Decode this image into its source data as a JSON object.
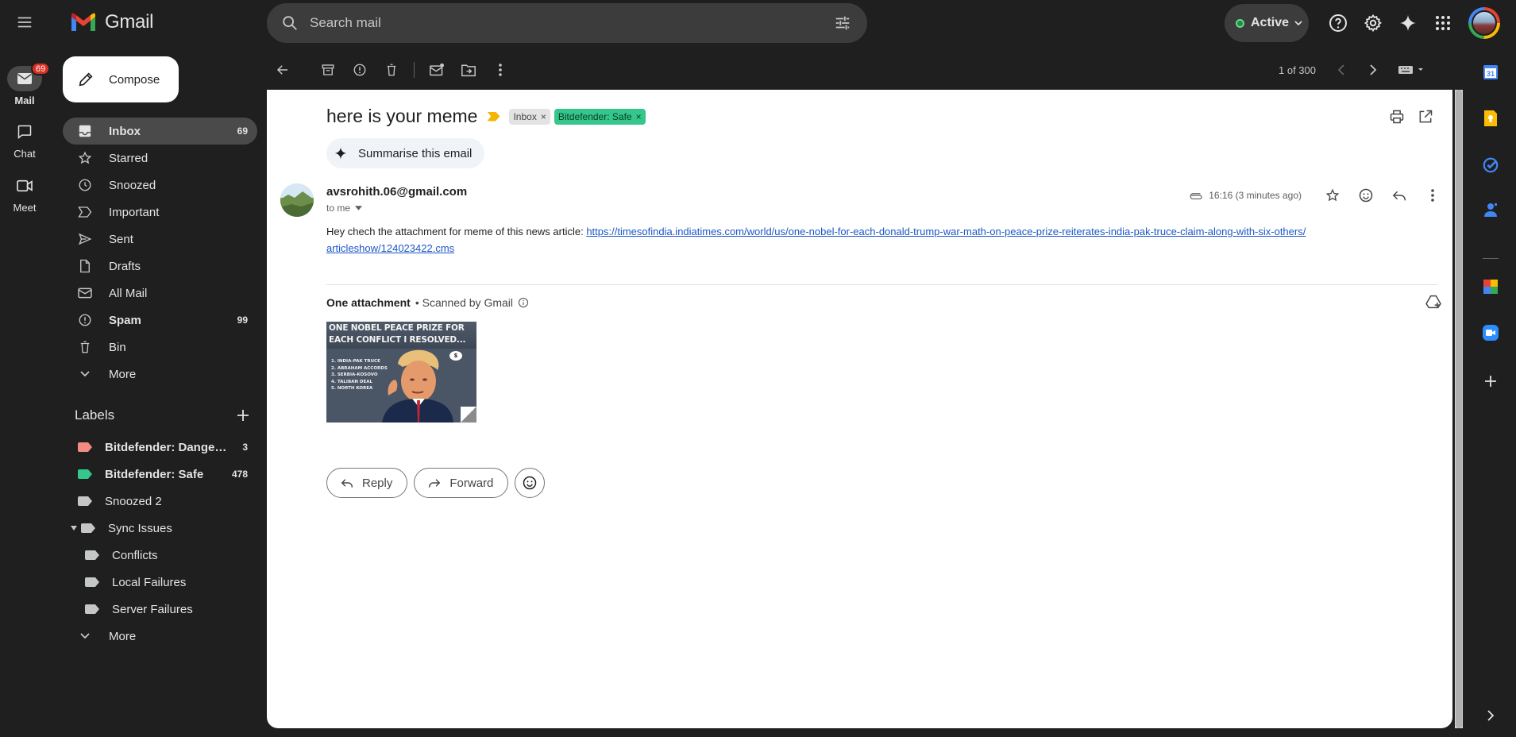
{
  "app": {
    "name": "Gmail"
  },
  "search": {
    "placeholder": "Search mail"
  },
  "status": {
    "label": "Active"
  },
  "rail": {
    "items": [
      {
        "label": "Mail",
        "badge": "69",
        "active": true
      },
      {
        "label": "Chat"
      },
      {
        "label": "Meet"
      }
    ]
  },
  "compose": {
    "label": "Compose"
  },
  "nav": {
    "items": [
      {
        "label": "Inbox",
        "count": "69"
      },
      {
        "label": "Starred",
        "count": ""
      },
      {
        "label": "Snoozed",
        "count": ""
      },
      {
        "label": "Important",
        "count": ""
      },
      {
        "label": "Sent",
        "count": ""
      },
      {
        "label": "Drafts",
        "count": ""
      },
      {
        "label": "All Mail",
        "count": ""
      },
      {
        "label": "Spam",
        "count": "99"
      },
      {
        "label": "Bin",
        "count": ""
      },
      {
        "label": "More",
        "count": ""
      }
    ]
  },
  "labels": {
    "title": "Labels",
    "items": [
      {
        "label": "Bitdefender: Dange…",
        "count": "3",
        "color": "#f28b82"
      },
      {
        "label": "Bitdefender: Safe",
        "count": "478",
        "color": "#34c68a"
      },
      {
        "label": "Snoozed 2",
        "count": "",
        "color": "#c4c7c5"
      },
      {
        "label": "Sync Issues",
        "count": "",
        "color": "#c4c7c5"
      },
      {
        "label": "Conflicts",
        "count": "",
        "color": "#c4c7c5"
      },
      {
        "label": "Local Failures",
        "count": "",
        "color": "#c4c7c5"
      },
      {
        "label": "Server Failures",
        "count": "",
        "color": "#c4c7c5"
      }
    ],
    "more": "More"
  },
  "toolbar": {
    "pager": "1 of 300"
  },
  "email": {
    "subject": "here is your meme",
    "chips": {
      "inbox": "Inbox",
      "safe": "Bitdefender: Safe"
    },
    "summarise": "Summarise this email",
    "sender": "avsrohith.06@gmail.com",
    "to": "to me",
    "timestamp": "16:16 (3 minutes ago)",
    "body_prefix": "Hey chech the attachment for meme of this news article: ",
    "link_line1": "https://timesofindia.indiatimes.com/world/us/one-nobel-for-each-donald-trump-war-math-on-peace-prize-reiterates-india-pak-truce-claim-along-with-six-others/",
    "link_line2": "articleshow/124023422.cms",
    "attachment_title": "One attachment",
    "attachment_scan": "• Scanned by Gmail",
    "meme_caption": "ONE NOBEL PEACE PRIZE FOR EACH CONFLICT I RESOLVED...",
    "meme_list": [
      "1. INDIA-PAK TRUCE",
      "2. ABRAHAM ACCORDS",
      "3. SERBIA-KOSOVO",
      "4. TALIBAN DEAL",
      "5. NORTH KOREA"
    ],
    "meme_bubble": "$",
    "reply": "Reply",
    "forward": "Forward"
  }
}
